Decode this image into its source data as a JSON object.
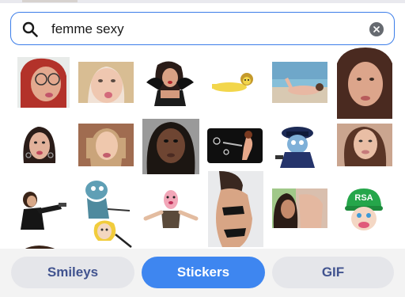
{
  "search": {
    "query": "femme sexy"
  },
  "icons": {
    "search": "search-icon",
    "clear": "clear-icon"
  },
  "stickers": [
    {
      "row": 1,
      "col": 1,
      "subject": "woman with glasses, tongue out"
    },
    {
      "row": 1,
      "col": 2,
      "subject": "blonde woman, tongue out"
    },
    {
      "row": 1,
      "col": 3,
      "subject": "woman with black lace gloves"
    },
    {
      "row": 1,
      "col": 4,
      "subject": "cartoon yellow figure lying down"
    },
    {
      "row": 1,
      "col": 5,
      "subject": "woman lying on beach"
    },
    {
      "row": 1,
      "col": 6,
      "subject": "woman with long brown hair"
    },
    {
      "row": 2,
      "col": 1,
      "subject": "woman with dark hair, earrings"
    },
    {
      "row": 2,
      "col": 2,
      "subject": "woman with pigtails"
    },
    {
      "row": 2,
      "col": 3,
      "subject": "woman close-up portrait"
    },
    {
      "row": 2,
      "col": 4,
      "subject": "cartoon woman shooting"
    },
    {
      "row": 2,
      "col": 5,
      "subject": "cartoon police character"
    },
    {
      "row": 2,
      "col": 6,
      "subject": "woman selfie"
    },
    {
      "row": 3,
      "col": 1,
      "subject": "woman aiming pistol"
    },
    {
      "row": 3,
      "col": 2,
      "subject": "cartoon characters with gun"
    },
    {
      "row": 3,
      "col": 3,
      "subject": "dancing figure with pink face"
    },
    {
      "row": 3,
      "col": 4,
      "subject": "woman in bikini"
    },
    {
      "row": 3,
      "col": 5,
      "subject": "couple close-up"
    },
    {
      "row": 3,
      "col": 6,
      "subject": "character with green RSA cap"
    }
  ],
  "rsa_cap_text": "RSA",
  "tabs": [
    {
      "label": "Smileys",
      "active": false
    },
    {
      "label": "Stickers",
      "active": true
    },
    {
      "label": "GIF",
      "active": false
    }
  ],
  "colors": {
    "accent": "#3e86f0",
    "search_border": "#3b7de9",
    "inactive_tab_text": "#41538f",
    "inactive_tab_bg": "#e5e6ea"
  }
}
